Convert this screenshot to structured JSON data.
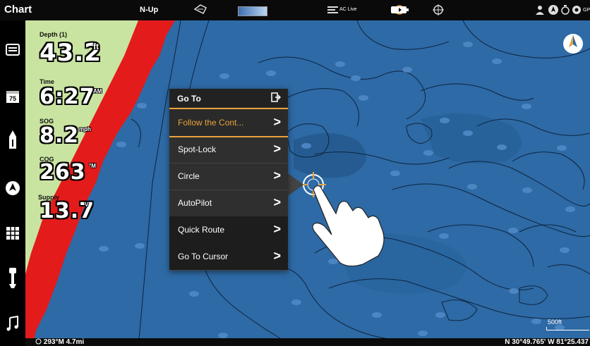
{
  "topbar": {
    "title": "Chart",
    "orientation": "N-Up",
    "aclive_label": "AC Live",
    "gps_label": "GP",
    "icons": [
      "nav-chart-icon",
      "depth-gradient-icon",
      "aclive-icon",
      "heading-icon",
      "battery-icon",
      "crosshair-icon",
      "person-icon",
      "compass-icon",
      "timer-icon",
      "settings-icon"
    ]
  },
  "sidebar": {
    "icons": [
      "chart-view-icon",
      "calendar-75-icon",
      "boat-icon",
      "radar-icon",
      "grid-icon",
      "outboard-motor-icon",
      "music-icon"
    ],
    "calendar_text": "75"
  },
  "readouts": {
    "depth": {
      "label": "Depth (1)",
      "value": "43.2",
      "unit": "ft"
    },
    "time": {
      "label": "Time",
      "value": "6:27",
      "unit": "AM"
    },
    "sog": {
      "label": "SOG",
      "value": "8.2",
      "unit": "mph"
    },
    "cog": {
      "label": "COG",
      "value": "263",
      "unit": "°M"
    },
    "supply": {
      "label": "Supply",
      "value": "13.7",
      "unit": "V"
    }
  },
  "goto_menu": {
    "title": "Go To",
    "items": [
      {
        "label": "Follow the Cont...",
        "arrow": ">"
      },
      {
        "label": "Spot-Lock",
        "arrow": ">"
      },
      {
        "label": "Circle",
        "arrow": ">"
      },
      {
        "label": "AutoPilot",
        "arrow": ">"
      },
      {
        "label": "Quick Route",
        "arrow": ">"
      },
      {
        "label": "Go To Cursor",
        "arrow": ">"
      }
    ]
  },
  "status": {
    "bearing_range": "293°M 4.7mi",
    "coordinates": "N 30°49.765' W 81°25.437",
    "scale": "500ft"
  },
  "colors": {
    "water": "#2e6aa5",
    "shore_red": "#e31b1b",
    "land_green": "#c9e4a0",
    "menu_accent": "#e8a23a"
  }
}
